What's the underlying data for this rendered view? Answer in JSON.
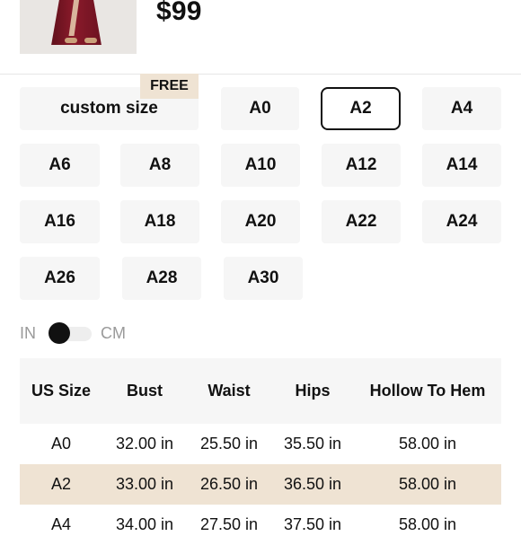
{
  "header": {
    "price": "$99"
  },
  "badge": {
    "free_label": "FREE"
  },
  "sizes": {
    "custom_label": "custom size",
    "options": [
      "A0",
      "A2",
      "A4",
      "A6",
      "A8",
      "A10",
      "A12",
      "A14",
      "A16",
      "A18",
      "A20",
      "A22",
      "A24",
      "A26",
      "A28",
      "A30"
    ],
    "selected": "A2"
  },
  "unit_toggle": {
    "left_label": "IN",
    "right_label": "CM",
    "active": "IN"
  },
  "size_table": {
    "headers": [
      "US Size",
      "Bust",
      "Waist",
      "Hips",
      "Hollow To Hem"
    ],
    "rows": [
      [
        "A0",
        "32.00 in",
        "25.50 in",
        "35.50 in",
        "58.00 in"
      ],
      [
        "A2",
        "33.00 in",
        "26.50 in",
        "36.50 in",
        "58.00 in"
      ],
      [
        "A4",
        "34.00 in",
        "27.50 in",
        "37.50 in",
        "58.00 in"
      ]
    ],
    "highlight_row": "A2"
  },
  "colors": {
    "accent": "#efe3d3",
    "selected_border": "#111111",
    "button_bg": "#f6f6f6"
  }
}
